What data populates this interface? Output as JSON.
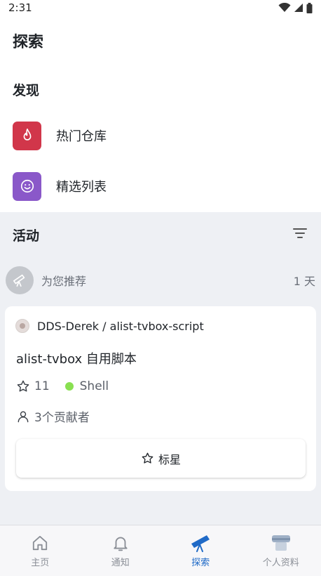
{
  "status_bar": {
    "time": "2:31"
  },
  "page": {
    "title": "探索"
  },
  "discover": {
    "heading": "发现",
    "items": [
      {
        "label": "热门仓库",
        "icon": "flame-icon",
        "color": "#d1364a"
      },
      {
        "label": "精选列表",
        "icon": "smiley-icon",
        "color": "#8a58c9"
      }
    ]
  },
  "activity": {
    "heading": "活动",
    "recommendation": {
      "label": "为您推荐",
      "time": "1 天"
    },
    "card": {
      "repo": "DDS-Derek / alist-tvbox-script",
      "description": "alist-tvbox 自用脚本",
      "stars": "11",
      "language": "Shell",
      "language_color": "#89e051",
      "contributors": "3个贡献者",
      "star_button": "标星"
    }
  },
  "nav": {
    "items": [
      {
        "label": "主页",
        "icon": "home-icon"
      },
      {
        "label": "通知",
        "icon": "bell-icon"
      },
      {
        "label": "探索",
        "icon": "telescope-icon",
        "active": true
      },
      {
        "label": "个人资料",
        "icon": "avatar-icon"
      }
    ]
  }
}
